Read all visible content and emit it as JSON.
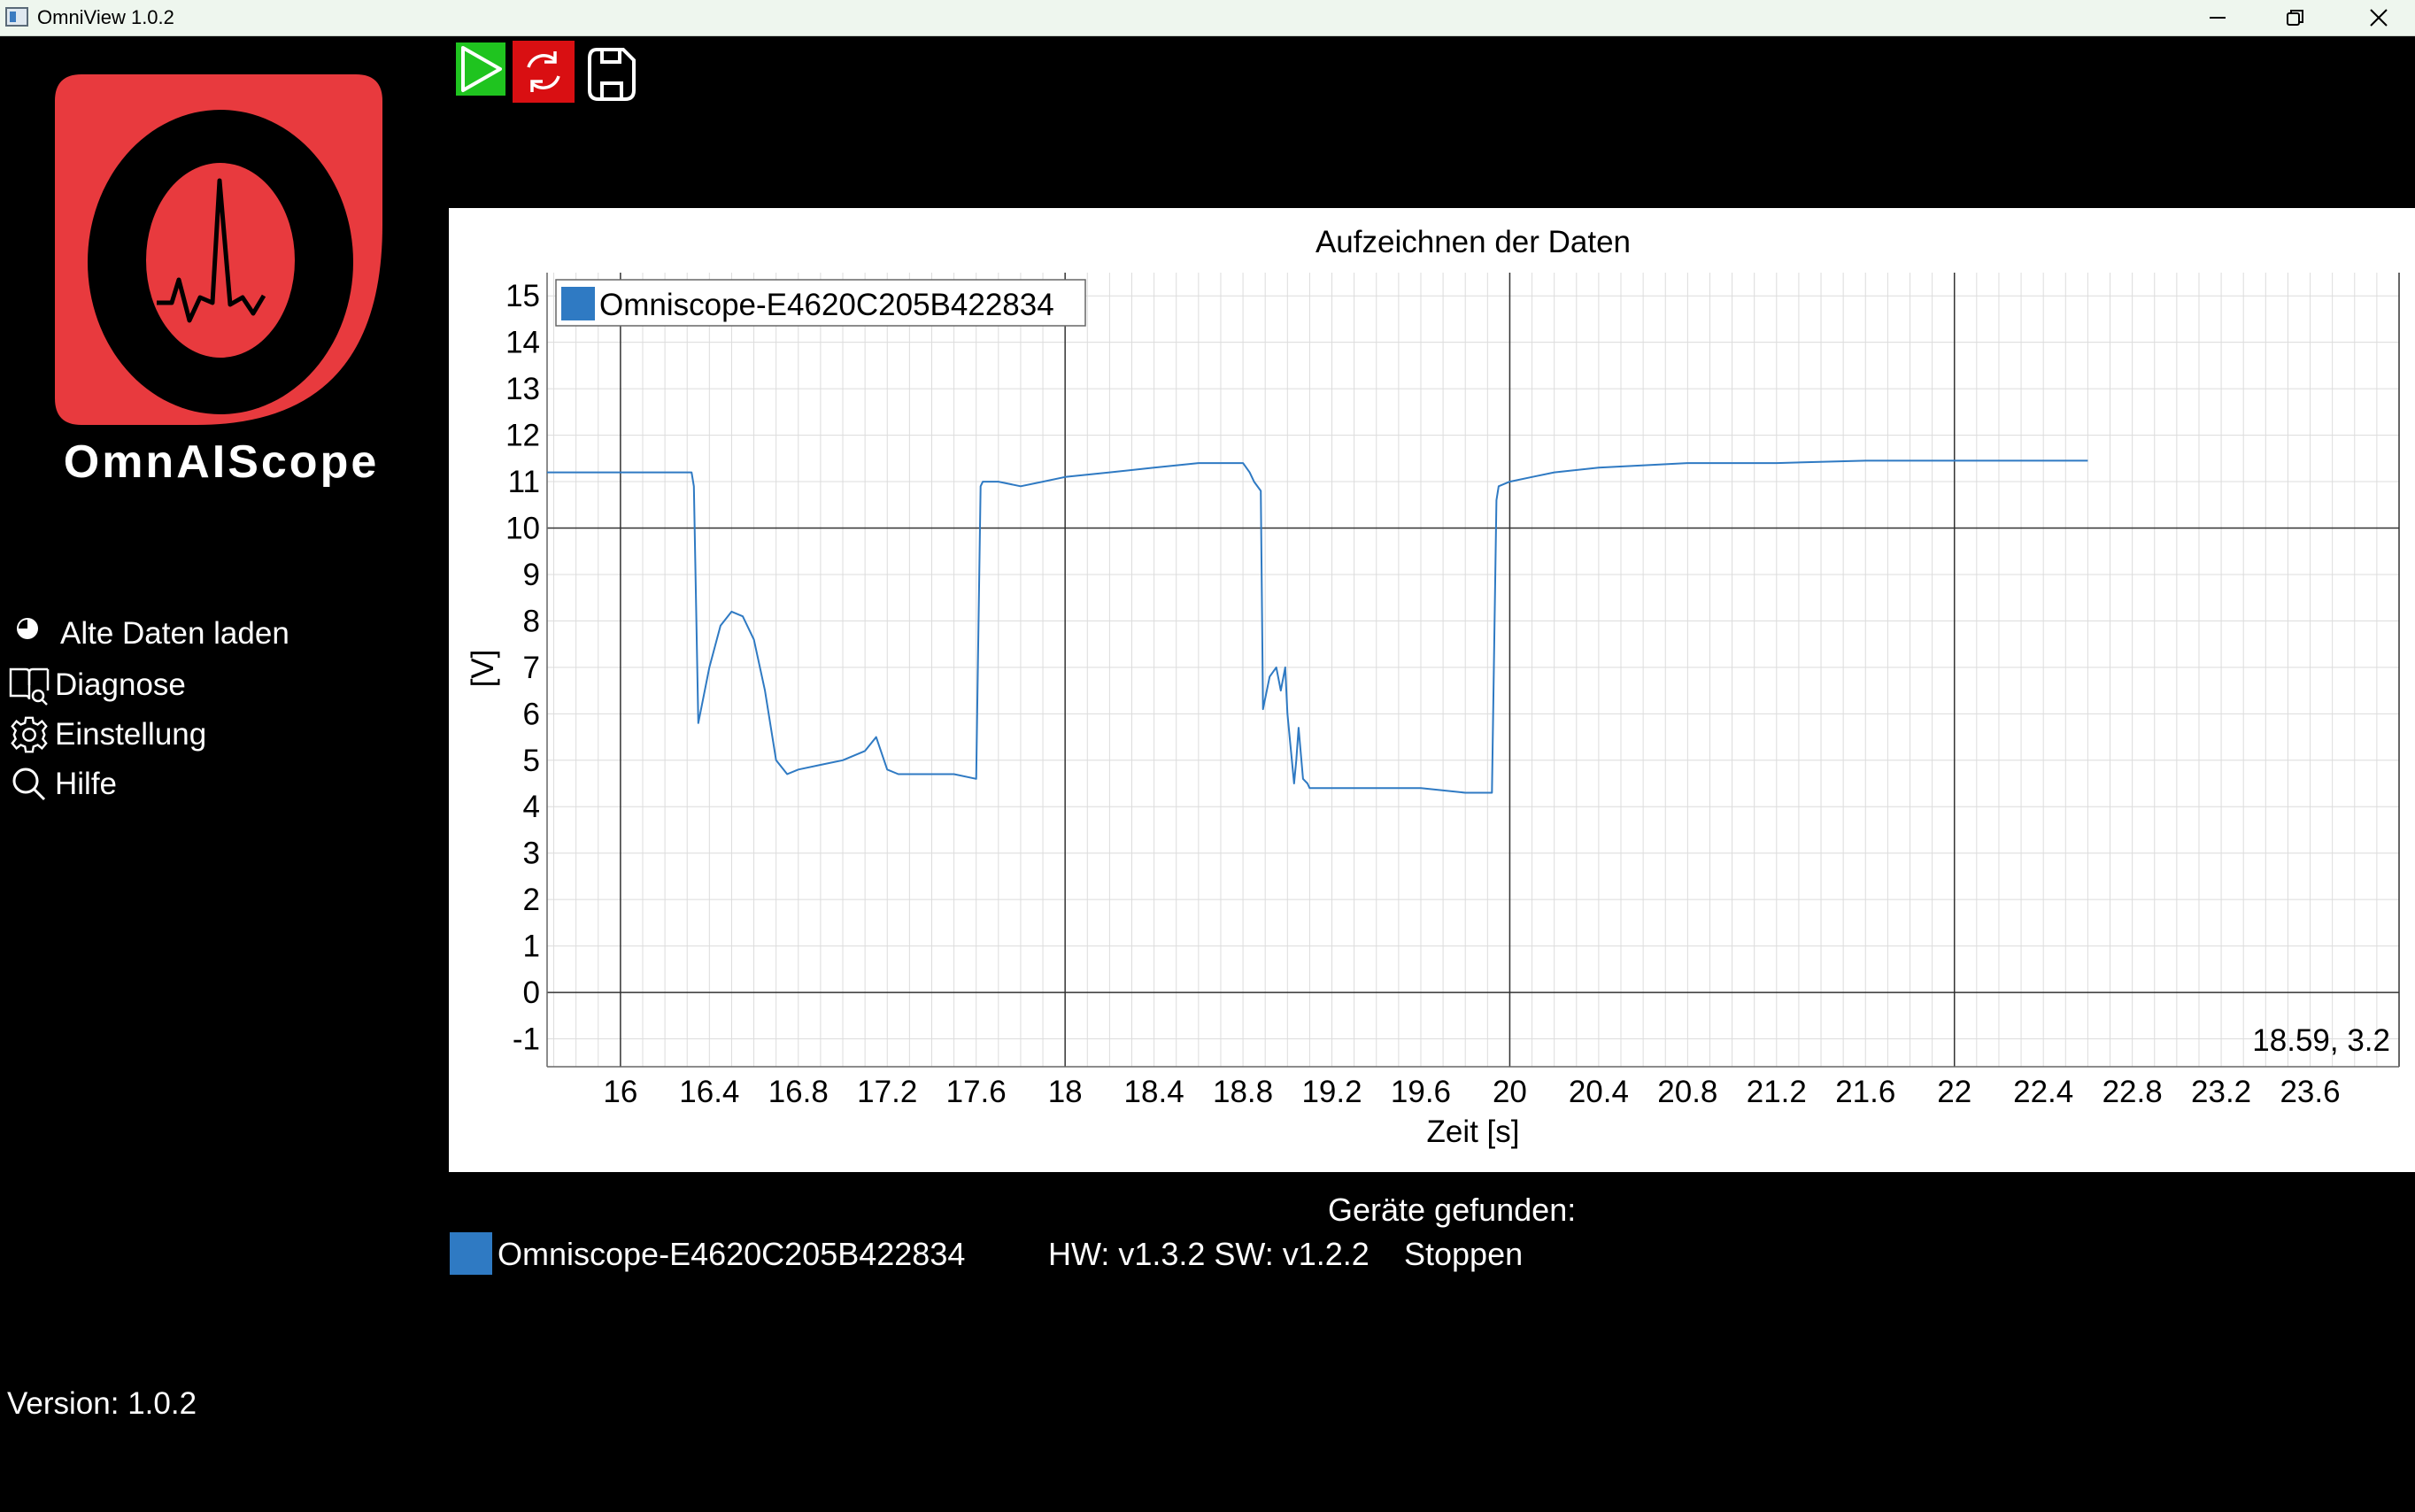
{
  "window": {
    "title": "OmniView 1.0.2",
    "minimize_icon": "minimize-icon",
    "maximize_icon": "restore-icon",
    "close_icon": "close-icon"
  },
  "sidebar": {
    "brand": "OmnAIScope",
    "logo_color": "#e83a3e",
    "items": [
      {
        "label": "Alte Daten laden",
        "icon": "load-icon"
      },
      {
        "label": "Diagnose",
        "icon": "book-search-icon"
      },
      {
        "label": "Einstellung",
        "icon": "gear-icon"
      },
      {
        "label": "Hilfe",
        "icon": "search-icon"
      }
    ],
    "version": "Version: 1.0.2"
  },
  "toolbar": {
    "play_icon": "play-icon",
    "reset_icon": "refresh-icon",
    "save_icon": "save-icon",
    "play_color": "#1fc41f",
    "reset_color": "#d90f12"
  },
  "chart_data": {
    "type": "line",
    "title": "Aufzeichnen der Daten",
    "xlabel": "Zeit [s]",
    "ylabel": "[V]",
    "xlim": [
      15.67,
      24.0
    ],
    "ylim": [
      -1.6,
      15.5
    ],
    "x_ticks": [
      "16",
      "16.4",
      "16.8",
      "17.2",
      "17.6",
      "18",
      "18.4",
      "18.8",
      "19.2",
      "19.6",
      "20",
      "20.4",
      "20.8",
      "21.2",
      "21.6",
      "22",
      "22.4",
      "22.8",
      "23.2",
      "23.6"
    ],
    "y_ticks": [
      "15",
      "14",
      "13",
      "12",
      "11",
      "10",
      "9",
      "8",
      "7",
      "6",
      "5",
      "4",
      "3",
      "2",
      "1",
      "0",
      "-1"
    ],
    "grid": true,
    "legend_placement": "top-left",
    "cursor_readout": "18.59, 3.2",
    "series": [
      {
        "name": "Omniscope-E4620C205B422834",
        "color": "#2f7ac3",
        "x": [
          15.67,
          16.32,
          16.33,
          16.35,
          16.4,
          16.45,
          16.5,
          16.55,
          16.6,
          16.65,
          16.7,
          16.75,
          16.8,
          16.9,
          17.0,
          17.1,
          17.15,
          17.2,
          17.25,
          17.3,
          17.4,
          17.5,
          17.6,
          17.62,
          17.63,
          17.7,
          17.8,
          17.9,
          18.0,
          18.2,
          18.4,
          18.6,
          18.8,
          18.83,
          18.85,
          18.88,
          18.89,
          18.92,
          18.95,
          18.97,
          18.99,
          19.0,
          19.03,
          19.04,
          19.05,
          19.07,
          19.09,
          19.1,
          19.2,
          19.4,
          19.6,
          19.8,
          19.92,
          19.94,
          19.95,
          20.0,
          20.1,
          20.2,
          20.4,
          20.8,
          21.2,
          21.6,
          22.0,
          22.3,
          22.6
        ],
        "y": [
          11.2,
          11.2,
          10.9,
          5.8,
          7.0,
          7.9,
          8.2,
          8.1,
          7.6,
          6.5,
          5.0,
          4.7,
          4.8,
          4.9,
          5.0,
          5.2,
          5.5,
          4.8,
          4.7,
          4.7,
          4.7,
          4.7,
          4.6,
          10.9,
          11.0,
          11.0,
          10.9,
          11.0,
          11.1,
          11.2,
          11.3,
          11.4,
          11.4,
          11.2,
          11.0,
          10.8,
          6.1,
          6.8,
          7.0,
          6.5,
          7.0,
          6.0,
          4.5,
          5.0,
          5.7,
          4.6,
          4.5,
          4.4,
          4.4,
          4.4,
          4.4,
          4.3,
          4.3,
          10.6,
          10.9,
          11.0,
          11.1,
          11.2,
          11.3,
          11.4,
          11.4,
          11.45,
          11.45,
          11.45,
          11.45
        ]
      }
    ]
  },
  "devices": {
    "title": "Geräte gefunden:",
    "items": [
      {
        "name": "Omniscope-E4620C205B422834",
        "version": "HW: v1.3.2 SW: v1.2.2",
        "action": "Stoppen",
        "color": "#2f7ac3"
      }
    ]
  }
}
